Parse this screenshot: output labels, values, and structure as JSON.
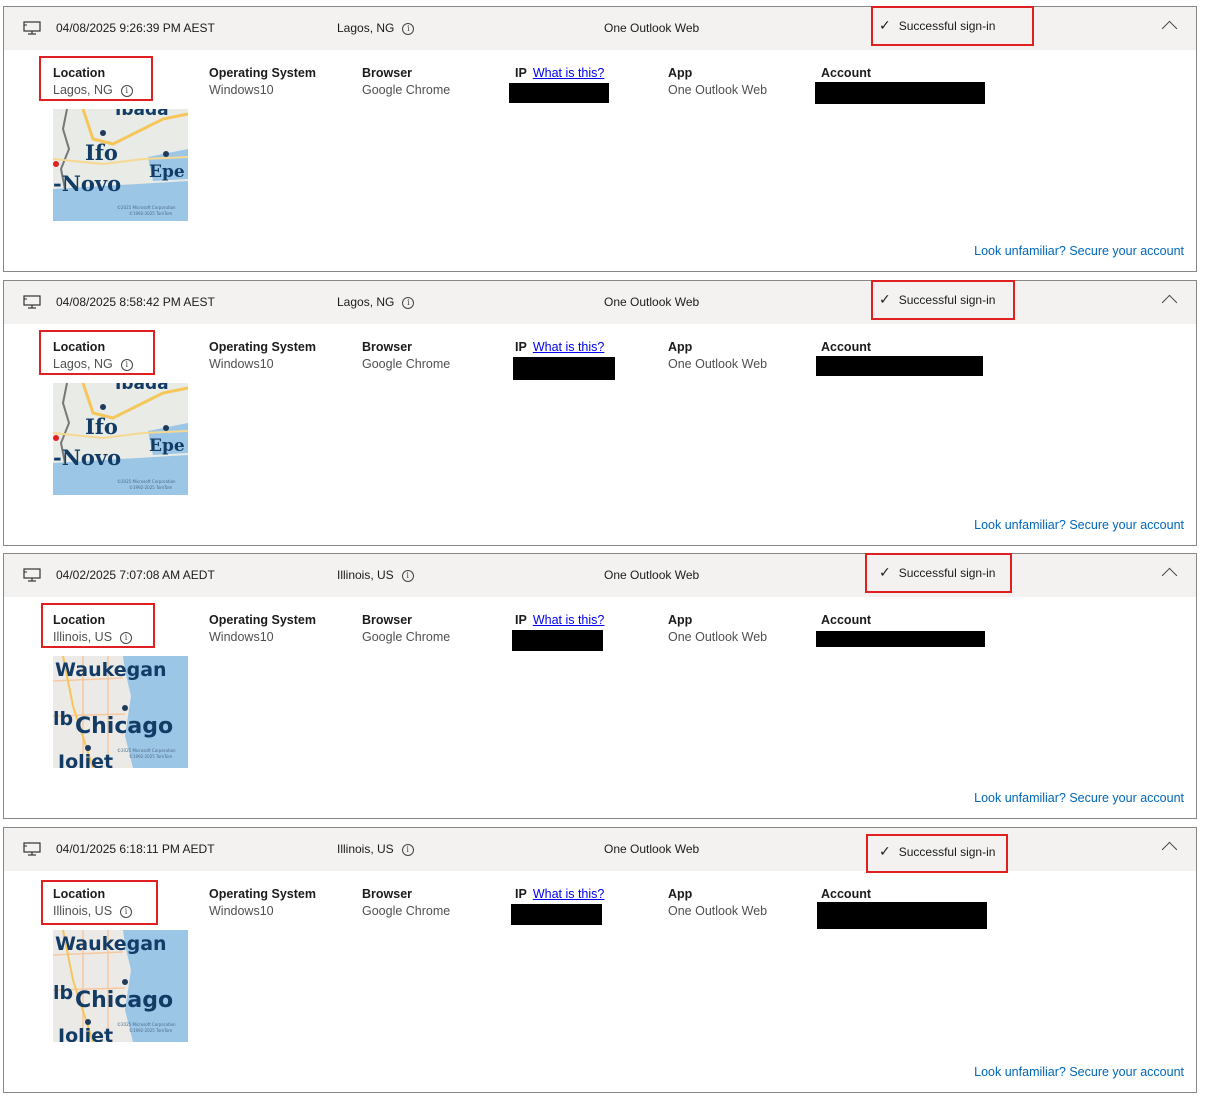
{
  "colors": {
    "header_bg": "#f3f2f1",
    "highlight": "#e02020",
    "link": "#0067b8",
    "redaction": "#000000"
  },
  "icons": {
    "device": "monitor-icon",
    "info": "info-icon",
    "check": "checkmark-icon",
    "collapse": "chevron-up-icon"
  },
  "labels": {
    "location": "Location",
    "os": "Operating System",
    "browser": "Browser",
    "ip": "IP",
    "ip_help": "What is this?",
    "app": "App",
    "account": "Account",
    "secure_link": "Look unfamiliar? Secure your account"
  },
  "entries": [
    {
      "datetime": "04/08/2025 9:26:39 PM AEST",
      "location": "Lagos, NG",
      "app": "One Outlook Web",
      "status": "Successful sign-in",
      "os": "Windows10",
      "browser": "Google Chrome",
      "map": {
        "labels": [
          "Ibada",
          "Ifo",
          "Epe",
          "-Novo"
        ],
        "copyright": [
          "©2025 Microsoft Corporation",
          "©1992-2025 TomTom"
        ]
      }
    },
    {
      "datetime": "04/08/2025 8:58:42 PM AEST",
      "location": "Lagos, NG",
      "app": "One Outlook Web",
      "status": "Successful sign-in",
      "os": "Windows10",
      "browser": "Google Chrome",
      "map": {
        "labels": [
          "Ibada",
          "Ifo",
          "Epe",
          "-Novo"
        ],
        "copyright": [
          "©2025 Microsoft Corporation",
          "©1992-2025 TomTom"
        ]
      }
    },
    {
      "datetime": "04/02/2025 7:07:08 AM AEDT",
      "location": "Illinois, US",
      "app": "One Outlook Web",
      "status": "Successful sign-in",
      "os": "Windows10",
      "browser": "Google Chrome",
      "map": {
        "labels": [
          "Waukegan",
          "lb",
          "Chicago",
          "Joliet"
        ],
        "copyright": [
          "©2025 Microsoft Corporation",
          "©1992-2025 TomTom"
        ]
      }
    },
    {
      "datetime": "04/01/2025 6:18:11 PM AEDT",
      "location": "Illinois, US",
      "app": "One Outlook Web",
      "status": "Successful sign-in",
      "os": "Windows10",
      "browser": "Google Chrome",
      "map": {
        "labels": [
          "Waukegan",
          "lb",
          "Chicago",
          "Joliet"
        ],
        "copyright": [
          "©2025 Microsoft Corporation",
          "©1992-2025 TomTom"
        ]
      }
    }
  ]
}
